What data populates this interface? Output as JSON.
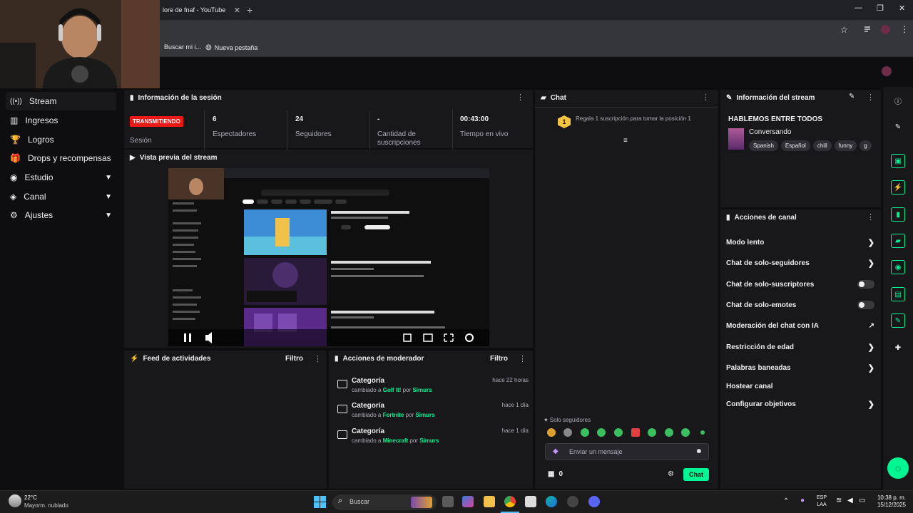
{
  "browser": {
    "tab_title": "lore de fnaf - YouTube",
    "tab_close": "✕",
    "new_tab": "+",
    "bookmarks": [
      "Buscar mi i...",
      "Nueva pestaña"
    ]
  },
  "sidebar": {
    "items": [
      {
        "label": "Stream",
        "icon": "broadcast-icon",
        "active": true
      },
      {
        "label": "Ingresos",
        "icon": "revenue-icon"
      },
      {
        "label": "Logros",
        "icon": "trophy-icon"
      },
      {
        "label": "Drops y recompensas",
        "icon": "gift-icon"
      },
      {
        "label": "Estudio",
        "icon": "studio-icon",
        "expandable": true
      },
      {
        "label": "Canal",
        "icon": "channel-icon",
        "expandable": true
      },
      {
        "label": "Ajustes",
        "icon": "gear-icon",
        "expandable": true
      }
    ]
  },
  "session": {
    "title": "Información de la sesión",
    "status_badge": "TRANSMITIENDO",
    "status_label": "Sesión",
    "stats": [
      {
        "value": "6",
        "label": "Espectadores"
      },
      {
        "value": "24",
        "label": "Seguidores"
      },
      {
        "value": "-",
        "label": "Cantidad de suscripciones"
      },
      {
        "value": "00:43:00",
        "label": "Tiempo en vivo"
      }
    ]
  },
  "preview": {
    "title": "Vista previa del stream"
  },
  "activity_feed": {
    "title": "Feed de actividades",
    "filter": "Filtro"
  },
  "mod_actions": {
    "title": "Acciones de moderador",
    "filter": "Filtro",
    "rows": [
      {
        "title": "Categoría",
        "prefix": "cambiado a",
        "target": "Golf It!",
        "by": "por",
        "user": "Simurs",
        "time": "hace 22 horas"
      },
      {
        "title": "Categoría",
        "prefix": "cambiado a",
        "target": "Fortnite",
        "by": "por",
        "user": "Simurs",
        "time": "hace 1 día"
      },
      {
        "title": "Categoría",
        "prefix": "cambiado a",
        "target": "Minecraft",
        "by": "por",
        "user": "Simurs",
        "time": "hace 1 día"
      }
    ]
  },
  "chat": {
    "title": "Chat",
    "gift_badge": "1",
    "gift_text": "Regala 1 suscripción para tomar la posición 1",
    "followers_only": "Solo seguidores",
    "placeholder": "Enviar un mensaje",
    "points": "0",
    "send_label": "Chat"
  },
  "stream_info": {
    "title": "Información del stream",
    "stream_title": "HABLEMOS ENTRE TODOS",
    "category": "Conversando",
    "tags": [
      "Spanish",
      "Español",
      "chill",
      "funny",
      "g"
    ]
  },
  "channel_actions": {
    "title": "Acciones de canal",
    "items": [
      {
        "label": "Modo lento",
        "control": "chevron"
      },
      {
        "label": "Chat de solo-seguidores",
        "control": "chevron"
      },
      {
        "label": "Chat de solo-suscriptores",
        "control": "toggle",
        "on": false
      },
      {
        "label": "Chat de solo-emotes",
        "control": "toggle",
        "on": false
      },
      {
        "label": "Moderación del chat con IA",
        "control": "external"
      },
      {
        "label": "Restricción de edad",
        "control": "chevron"
      },
      {
        "label": "Palabras baneadas",
        "control": "chevron"
      },
      {
        "label": "Hostear canal",
        "control": "none"
      },
      {
        "label": "Configurar objetivos",
        "control": "chevron"
      }
    ]
  },
  "taskbar": {
    "weather_temp": "22°C",
    "weather_desc": "Mayorm. nublado",
    "search": "Buscar",
    "lang1": "ESP",
    "lang2": "LAA",
    "time": "10:38 p. m.",
    "date": "15/12/2025"
  },
  "colors": {
    "accent": "#00f593",
    "live": "#e91916",
    "gold": "#f6c343",
    "panel": "#18181b",
    "bg": "#0e0e10"
  }
}
